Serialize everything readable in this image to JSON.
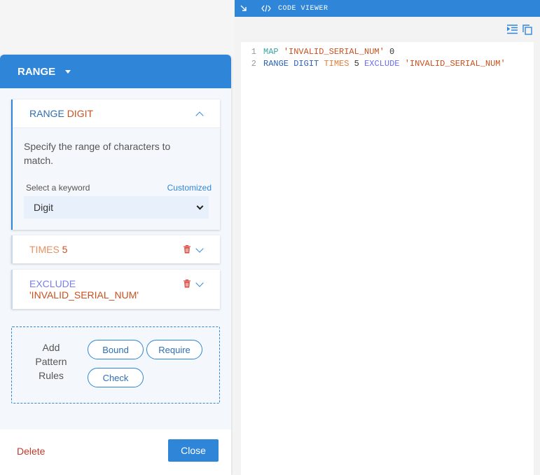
{
  "code_viewer": {
    "title": "CODE VIEWER",
    "lines": [
      {
        "num": "1",
        "tokens": {
          "t1": "MAP",
          "t2": "'INVALID_SERIAL_NUM'",
          "t3": "0"
        }
      },
      {
        "num": "2",
        "tokens": {
          "t1": "RANGE",
          "t2": "DIGIT",
          "t3": "TIMES",
          "t4": "5",
          "t5": "EXCLUDE",
          "t6": "'INVALID_SERIAL_NUM'"
        }
      }
    ]
  },
  "panel": {
    "title": "RANGE",
    "range_card": {
      "keyword": "RANGE",
      "value": "DIGIT",
      "description": "Specify the range of characters to match.",
      "select_label": "Select a keyword",
      "customized_link": "Customized",
      "selected": "Digit"
    },
    "times_card": {
      "keyword": "TIMES",
      "value": "5"
    },
    "exclude_card": {
      "keyword": "EXCLUDE",
      "value": "'INVALID_SERIAL_NUM'"
    },
    "add_rules": {
      "label_line1": "Add",
      "label_line2": "Pattern",
      "label_line3": "Rules",
      "buttons": [
        "Bound",
        "Require",
        "Check"
      ]
    },
    "footer": {
      "delete": "Delete",
      "close": "Close"
    }
  },
  "colors": {
    "accent": "#2f86d8",
    "delete": "#c0392b",
    "keyword_string": "#c9501e"
  },
  "icons": [
    "collapse-arrow-icon",
    "code-icon",
    "indent-icon",
    "copy-icon",
    "trash-icon",
    "chevron-down-icon",
    "chevron-up-icon"
  ]
}
